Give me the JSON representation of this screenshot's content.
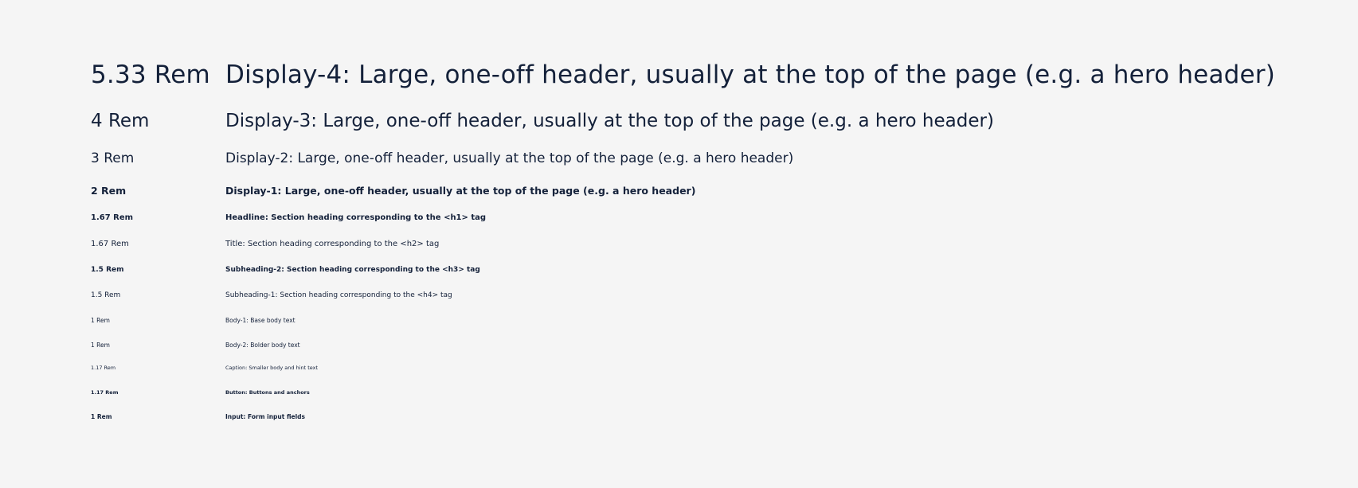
{
  "type_scale": {
    "rows": [
      {
        "size": "5.33 Rem",
        "sample": "Display-4: Large, one-off header, usually at the top of the page (e.g. a hero header)"
      },
      {
        "size": "4 Rem",
        "sample": "Display-3: Large, one-off header, usually at the top of the page (e.g. a hero header)"
      },
      {
        "size": "3 Rem",
        "sample": "Display-2: Large, one-off header, usually at the top of the page (e.g. a hero header)"
      },
      {
        "size": "2 Rem",
        "sample": "Display-1: Large, one-off header, usually at the top of the page (e.g. a hero header)"
      },
      {
        "size": "1.67 Rem",
        "sample": "Headline: Section heading corresponding to the <h1> tag"
      },
      {
        "size": "1.67 Rem",
        "sample": "Title: Section heading corresponding to the <h2> tag"
      },
      {
        "size": "1.5 Rem",
        "sample": "Subheading-2: Section heading corresponding to the <h3> tag"
      },
      {
        "size": "1.5 Rem",
        "sample": "Subheading-1: Section heading corresponding to the <h4> tag"
      },
      {
        "size": "1 Rem",
        "sample": "Body-1: Base body text"
      },
      {
        "size": "1 Rem",
        "sample": "Body-2: Bolder body text"
      },
      {
        "size": "1.17 Rem",
        "sample": "Caption: Smaller body and hint text"
      },
      {
        "size": "1.17 Rem",
        "sample": "Button: Buttons and anchors"
      },
      {
        "size": "1 Rem",
        "sample": "Input: Form input fields"
      }
    ]
  },
  "colors": {
    "background": "#f5f5f5",
    "text": "#14213a"
  }
}
